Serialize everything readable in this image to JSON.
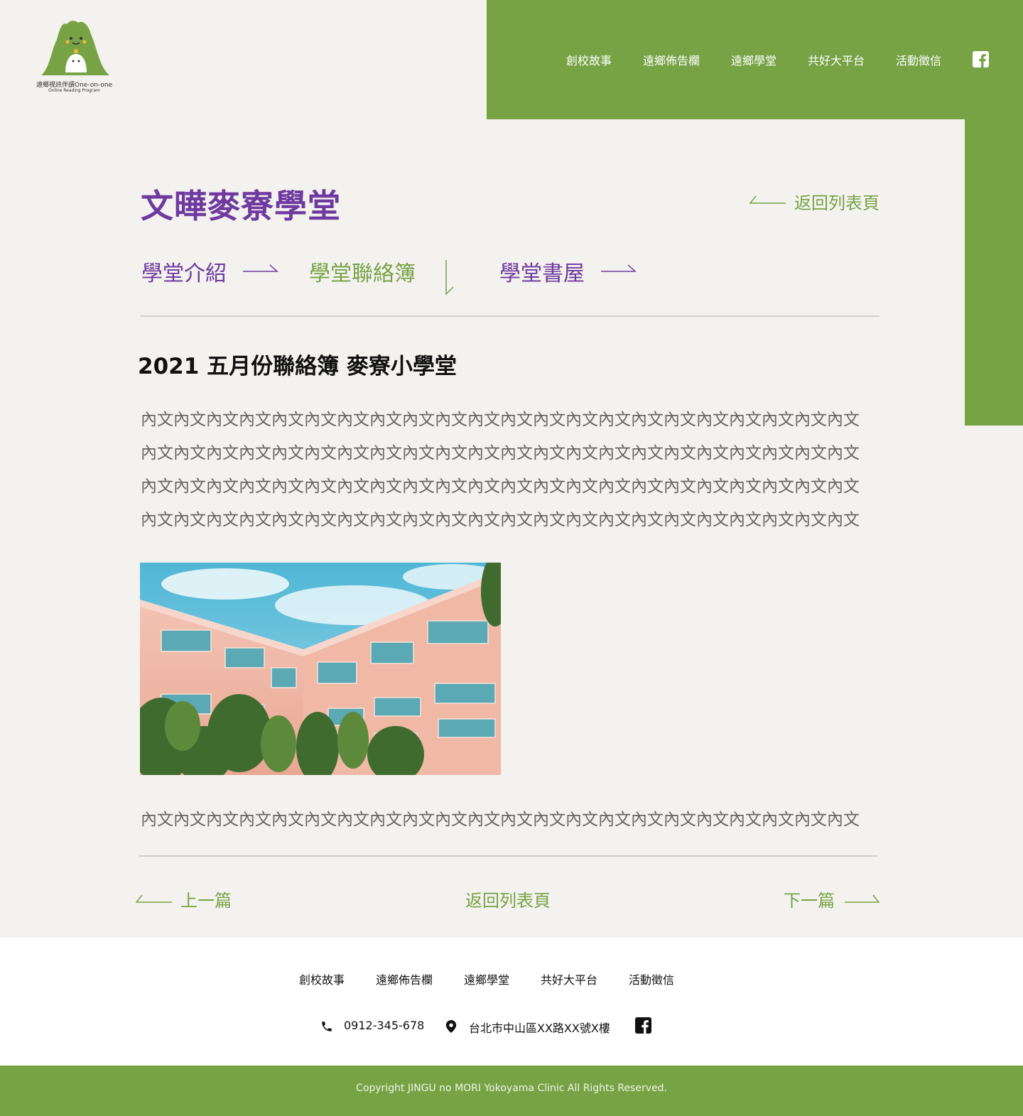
{
  "brand": {
    "logo_text": "遠鄉視訊伴讀One-on-one",
    "logo_sub": "Online Reading Program"
  },
  "header": {
    "nav": [
      "創校故事",
      "遠鄉佈告欄",
      "遠鄉學堂",
      "共好大平台",
      "活動徵信"
    ]
  },
  "page": {
    "title": "文曄麥寮學堂",
    "back_label": "返回列表頁",
    "tabs": [
      "學堂介紹",
      "學堂聯絡簿",
      "學堂書屋"
    ]
  },
  "post": {
    "title": "2021 五月份聯絡簿 麥寮小學堂",
    "paragraph_lines": [
      "內文內文內文內文內文內文內文內文內文內文內文內文內文內文內文內文內文內文內文內文內文內文",
      "內文內文內文內文內文內文內文內文內文內文內文內文內文內文內文內文內文內文內文內文內文內文",
      "內文內文內文內文內文內文內文內文內文內文內文內文內文內文內文內文內文內文內文內文內文內文",
      "內文內文內文內文內文內文內文內文內文內文內文內文內文內文內文內文內文內文內文內文內文內文"
    ],
    "paragraph_after": "內文內文內文內文內文內文內文內文內文內文內文內文內文內文內文內文內文內文內文內文內文內文"
  },
  "pager": {
    "prev": "上一篇",
    "back": "返回列表頁",
    "next": "下一篇"
  },
  "footer": {
    "nav": [
      "創校故事",
      "遠鄉佈告欄",
      "遠鄉學堂",
      "共好大平台",
      "活動徵信"
    ],
    "phone": "0912-345-678",
    "address": "台北市中山區XX路XX號X樓",
    "copyright": "Copyright JINGU no MORI Yokoyama Clinic All Rights Reserved."
  },
  "colors": {
    "brand_green": "#77a345",
    "accent_purple": "#6f3a9f",
    "background": "#f3f2ef"
  }
}
